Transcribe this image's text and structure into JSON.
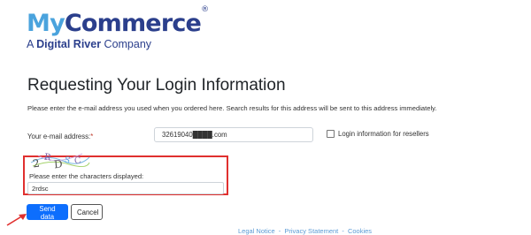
{
  "brand": {
    "name_part1": "My",
    "name_part2": "Commerce",
    "registered": "®",
    "tagline_prefix": "A ",
    "tagline_bold": "Digital River",
    "tagline_suffix": " Company"
  },
  "page": {
    "title": "Requesting Your Login Information",
    "intro": "Please enter the e-mail address you used when you ordered here. Search results for this address will be sent to this address immediately."
  },
  "form": {
    "email_label": "Your e-mail address:",
    "email_required": "*",
    "email_value": "32619040████.com",
    "reseller_label": "Login information for resellers",
    "reseller_checked": false,
    "captcha_text": "2RDSC",
    "captcha_label": "Please enter the characters displayed:",
    "captcha_value": "2rdsc",
    "send_label": "Send data",
    "cancel_label": "Cancel"
  },
  "footer": {
    "links": [
      "Legal Notice",
      "-",
      "Privacy Statement",
      "-",
      "Cookies"
    ]
  },
  "colors": {
    "brand_light": "#4aa3dd",
    "brand_dark": "#2b3f8c",
    "primary_button": "#0d6efd",
    "highlight_red": "#e0302f",
    "link": "#5b9bd5"
  }
}
